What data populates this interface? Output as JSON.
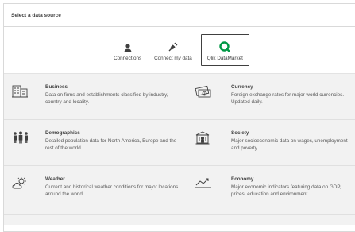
{
  "dialog": {
    "title": "Select a data source"
  },
  "sources": [
    {
      "label": "Connections",
      "icon": "person-icon"
    },
    {
      "label": "Connect my data",
      "icon": "plug-icon"
    },
    {
      "label": "Qlik DataMarket",
      "icon": "qlik-logo-icon",
      "selected": true
    }
  ],
  "categories": [
    {
      "title": "Business",
      "description": "Data on firms and establishments classified by industry, country and locality.",
      "icon": "building-icon"
    },
    {
      "title": "Currency",
      "description": "Foreign exchange rates for major world currencies. Updated daily.",
      "icon": "banknote-icon"
    },
    {
      "title": "Demographics",
      "description": "Detailed population data for North America, Europe and the rest of the world.",
      "icon": "people-group-icon"
    },
    {
      "title": "Society",
      "description": "Major socioeconomic data on wages, unemployment and poverty.",
      "icon": "institution-icon"
    },
    {
      "title": "Weather",
      "description": "Current and historical weather conditions for major locations around the world.",
      "icon": "weather-icon"
    },
    {
      "title": "Economy",
      "description": "Major economic indicators featuring data on GDP, prices, education and environment.",
      "icon": "trend-chart-icon"
    }
  ],
  "colors": {
    "accent": "#009845",
    "border": "#d9d9d9",
    "grid_background": "#f2f2f2",
    "text": "#404040"
  }
}
